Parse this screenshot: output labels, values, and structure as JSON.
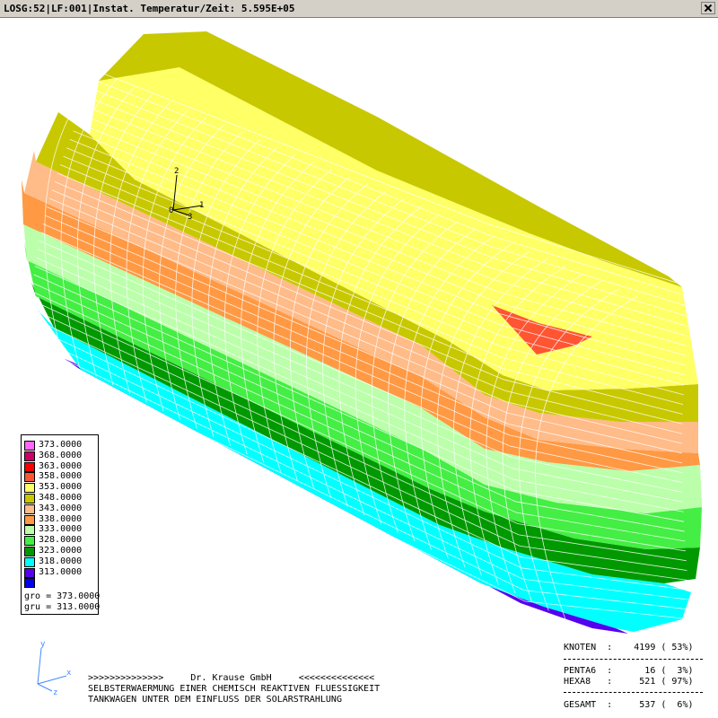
{
  "window": {
    "title": "LOSG:52|LF:001|Instat. Temperatur/Zeit: 5.595E+05"
  },
  "legend": {
    "entries": [
      {
        "label": "373.0000",
        "color": "#ff66ff"
      },
      {
        "label": "368.0000",
        "color": "#cc0066"
      },
      {
        "label": "363.0000",
        "color": "#ff0000"
      },
      {
        "label": "358.0000",
        "color": "#ff5533"
      },
      {
        "label": "353.0000",
        "color": "#ffff66"
      },
      {
        "label": "348.0000",
        "color": "#c8c800"
      },
      {
        "label": "343.0000",
        "color": "#ffbb88"
      },
      {
        "label": "338.0000",
        "color": "#ff9944"
      },
      {
        "label": "333.0000",
        "color": "#bbffaa"
      },
      {
        "label": "328.0000",
        "color": "#44ee44"
      },
      {
        "label": "323.0000",
        "color": "#009900"
      },
      {
        "label": "318.0000",
        "color": "#00ffff"
      },
      {
        "label": "313.0000",
        "color": "#5500ee"
      },
      {
        "label": "",
        "color": "#0000ee"
      }
    ],
    "gro": "gro = 373.0000",
    "gru": "gru = 313.0000"
  },
  "triad": {
    "label_1": "1",
    "label_2": "2",
    "label_3": "3",
    "label_0": "0"
  },
  "axes_icon": {
    "y": "y",
    "x": "x",
    "z": "z"
  },
  "footer": {
    "line1": ">>>>>>>>>>>>>>     Dr. Krause GmbH     <<<<<<<<<<<<<<",
    "line2": "SELBSTERWAERMUNG EINER CHEMISCH REAKTIVEN FLUESSIGKEIT",
    "line3": "TANKWAGEN UNTER DEM EINFLUSS DER SOLARSTRAHLUNG"
  },
  "stats": {
    "knoten": "KNOTEN  :    4199 ( 53%)",
    "penta": "PENTA6  :      16 (  3%)",
    "hexa": "HEXA8   :     521 ( 97%)",
    "gesamt": "GESAMT  :     537 (  6%)"
  },
  "colors": {
    "mesh_line": "#ffffff",
    "band_313": "#5500ee",
    "band_318": "#00ffff",
    "band_323": "#009900",
    "band_328": "#44ee44",
    "band_333": "#bbffaa",
    "band_338": "#ff9944",
    "band_343": "#ffbb88",
    "band_348": "#c8c800",
    "band_353": "#ffff66",
    "band_358": "#ff5533"
  }
}
